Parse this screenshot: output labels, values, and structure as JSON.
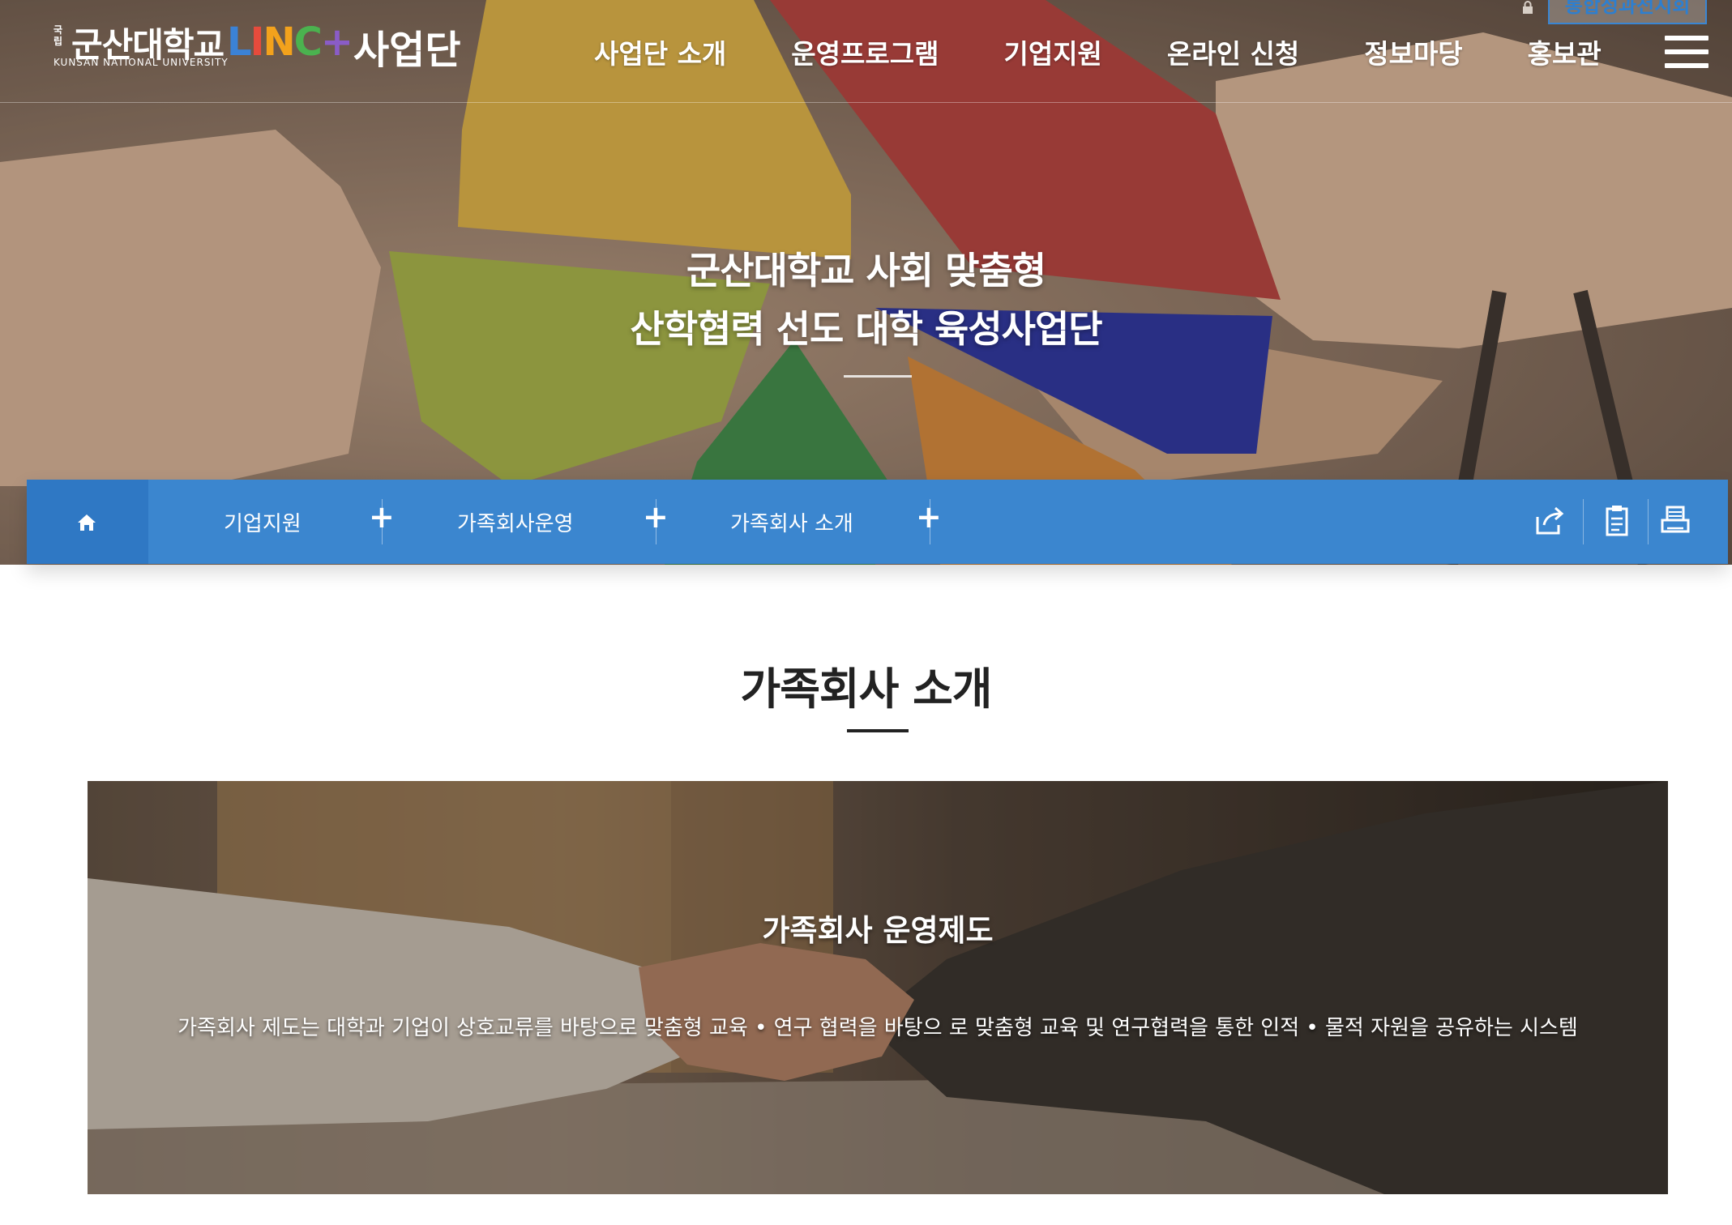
{
  "header": {
    "logo": {
      "seal": "국립",
      "name": "군산대학교",
      "english": "KUNSAN NATIONAL UNIVERSITY",
      "linc": [
        "L",
        "I",
        "N",
        "C",
        "+"
      ],
      "suffix": "사업단"
    },
    "exhibit_button": "통합성과전시회",
    "nav": [
      "사업단 소개",
      "운영프로그램",
      "기업지원",
      "온라인 신청",
      "정보마당",
      "홍보관"
    ]
  },
  "hero": {
    "line1": "군산대학교 사회 맞춤형",
    "line2": "산학협력 선도 대학 육성사업단"
  },
  "breadcrumb": {
    "items": [
      "기업지원",
      "가족회사운영",
      "가족회사 소개"
    ],
    "tools": [
      "share-icon",
      "clipboard-icon",
      "print-icon"
    ]
  },
  "content": {
    "title": "가족회사 소개",
    "banner_title": "가족회사 운영제도",
    "banner_text": "가족회사 제도는 대학과 기업이 상호교류를 바탕으로 맞춤형 교육 • 연구 협력을 바탕으 로 맞춤형 교육 및 연구협력을 통한 인적 • 물적 자원을 공유하는 시스템"
  },
  "colors": {
    "accent": "#3b86cf",
    "accent_dark": "#2f78c4",
    "title_text": "#222222"
  }
}
